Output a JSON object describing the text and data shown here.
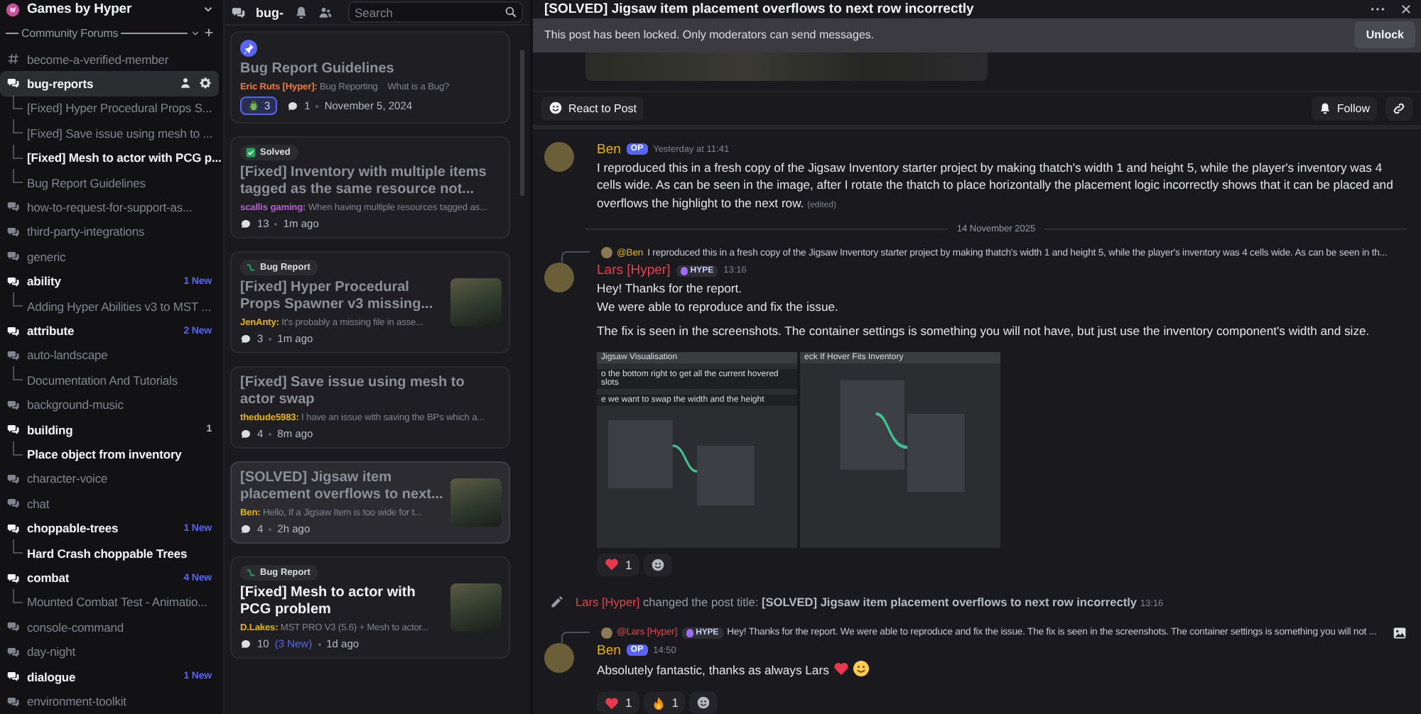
{
  "server": {
    "name": "Games by Hyper"
  },
  "sidebar": {
    "category": "Community Forums",
    "channels": [
      {
        "name": "become-a-verified-member",
        "kind": "text",
        "unread": false,
        "selected": false
      },
      {
        "name": "bug-reports",
        "kind": "forum",
        "unread": true,
        "selected": true,
        "threads": [
          {
            "title": "[Fixed] Hyper Procedural Props S...",
            "unread": false
          },
          {
            "title": "[Fixed] Save issue using mesh to ...",
            "unread": false
          },
          {
            "title": "[Fixed] Mesh to actor with PCG p...",
            "unread": true
          },
          {
            "title": "Bug Report Guidelines",
            "unread": false
          }
        ]
      },
      {
        "name": "how-to-request-for-support-as...",
        "kind": "forum",
        "unread": false,
        "selected": false
      },
      {
        "name": "third-party-integrations",
        "kind": "forum",
        "unread": false,
        "selected": false
      },
      {
        "name": "generic",
        "kind": "forum",
        "unread": false,
        "selected": false
      },
      {
        "name": "ability",
        "kind": "forum",
        "unread": true,
        "selected": false,
        "badge": {
          "text": "1 New",
          "kind": "new"
        },
        "threads": [
          {
            "title": "Adding Hyper Abilities v3 to MST ...",
            "unread": false
          }
        ]
      },
      {
        "name": "attribute",
        "kind": "forum",
        "unread": true,
        "selected": false,
        "badge": {
          "text": "2 New",
          "kind": "new"
        }
      },
      {
        "name": "auto-landscape",
        "kind": "forum",
        "unread": false,
        "selected": false,
        "threads": [
          {
            "title": "Documentation And Tutorials",
            "unread": false
          }
        ]
      },
      {
        "name": "background-music",
        "kind": "forum",
        "unread": false,
        "selected": false
      },
      {
        "name": "building",
        "kind": "forum",
        "unread": true,
        "selected": false,
        "badge": {
          "text": "1",
          "kind": "count"
        },
        "threads": [
          {
            "title": "Place object from inventory",
            "unread": true
          }
        ]
      },
      {
        "name": "character-voice",
        "kind": "forum",
        "unread": false,
        "selected": false
      },
      {
        "name": "chat",
        "kind": "forum",
        "unread": false,
        "selected": false
      },
      {
        "name": "choppable-trees",
        "kind": "forum",
        "unread": true,
        "selected": false,
        "badge": {
          "text": "1 New",
          "kind": "new"
        },
        "threads": [
          {
            "title": "Hard Crash choppable Trees",
            "unread": true
          }
        ]
      },
      {
        "name": "combat",
        "kind": "forum",
        "unread": true,
        "selected": false,
        "badge": {
          "text": "4 New",
          "kind": "new"
        },
        "threads": [
          {
            "title": "Mounted Combat Test - Animatio...",
            "unread": false
          }
        ]
      },
      {
        "name": "console-command",
        "kind": "forum",
        "unread": false,
        "selected": false
      },
      {
        "name": "day-night",
        "kind": "forum",
        "unread": false,
        "selected": false
      },
      {
        "name": "dialogue",
        "kind": "forum",
        "unread": true,
        "selected": false,
        "badge": {
          "text": "1 New",
          "kind": "new"
        }
      },
      {
        "name": "environment-toolkit",
        "kind": "forum",
        "unread": false,
        "selected": false
      }
    ]
  },
  "forum": {
    "channel_name": "bug-",
    "search": {
      "placeholder": "Search"
    },
    "posts": [
      {
        "pinned": true,
        "title": "Bug Report Guidelines",
        "unread": false,
        "selected": false,
        "author": {
          "name": "Eric Ruts [Hyper]:",
          "color": "#f0783c"
        },
        "snippet": "Bug Reporting    What is a Bug?",
        "reaction": {
          "count": "3"
        },
        "comments": "1",
        "time": "November 5, 2024",
        "thumbnail": false
      },
      {
        "pinned": false,
        "tag": {
          "label": "Solved",
          "kind": "solved"
        },
        "title": "[Fixed] Inventory with multiple items tagged as the same resource not...",
        "unread": false,
        "selected": false,
        "author": {
          "name": "scallis gaming:",
          "color": "#b55fd0"
        },
        "snippet": "When having multiple resources tagged as...",
        "comments": "13",
        "time": "1m ago",
        "thumbnail": false
      },
      {
        "pinned": false,
        "tag": {
          "label": "Bug Report",
          "kind": "bug"
        },
        "title": "[Fixed] Hyper Procedural Props Spawner v3 missing...",
        "unread": false,
        "selected": false,
        "author": {
          "name": "JenAnty:",
          "color": "#e8b400"
        },
        "snippet": "It's probably a missing file in asse...",
        "comments": "3",
        "time": "1m ago",
        "thumbnail": true
      },
      {
        "pinned": false,
        "title": "[Fixed] Save issue using mesh to actor swap",
        "unread": false,
        "selected": false,
        "author": {
          "name": "thedude5983:",
          "color": "#e8b400"
        },
        "snippet": "I have an issue with saving the BPs which a...",
        "comments": "4",
        "time": "8m ago",
        "thumbnail": false
      },
      {
        "pinned": false,
        "title": "[SOLVED] Jigsaw item placement overflows to next...",
        "unread": false,
        "selected": true,
        "author": {
          "name": "Ben:",
          "color": "#e8b400"
        },
        "snippet": "Hello, If a Jigsaw Item is too wide for t...",
        "comments": "4",
        "time": "2h ago",
        "thumbnail": true
      },
      {
        "pinned": false,
        "tag": {
          "label": "Bug Report",
          "kind": "bug"
        },
        "title": "[Fixed] Mesh to actor with PCG problem",
        "unread": true,
        "selected": false,
        "author": {
          "name": "D.Lakes:",
          "color": "#e8b400"
        },
        "snippet": "MST PRO V3 (5.6) + Mesh to actor...",
        "comments": "10",
        "new_comments": "(3 New)",
        "time": "1d ago",
        "thumbnail": true
      }
    ]
  },
  "thread": {
    "title": "[SOLVED] Jigsaw item placement overflows to next row incorrectly",
    "locked_notice": "This post has been locked. Only moderators can send messages.",
    "unlock_button": "Unlock",
    "react_button": "React to Post",
    "follow_button": "Follow",
    "items": [
      {
        "kind": "message",
        "author": {
          "name": "Ben",
          "color": "#e8b400"
        },
        "badge": {
          "text": "OP",
          "kind": "op"
        },
        "time": "Yesterday at 11:41",
        "paragraphs": [
          [
            "I reproduced this in a fresh copy of the Jigsaw Inventory starter project by making thatch's width 1 and height 5, while the player's inventory was 4 cells wide. As can be seen in the image, after I rotate the thatch to place horizontally the placement logic incorrectly shows that it can be placed and overflows the highlight to the next row."
          ]
        ],
        "edited": "(edited)"
      },
      {
        "kind": "divider",
        "text": "14 November 2025"
      },
      {
        "kind": "message",
        "reply": {
          "author": {
            "name": "@Ben",
            "color": "#e8b400"
          },
          "text": "I reproduced this in a fresh copy of the Jigsaw Inventory starter project by making thatch's width 1 and height 5, while the player's inventory was 4 cells wide. As can be seen in th..."
        },
        "author": {
          "name": "Lars [Hyper]",
          "color": "#e0454f"
        },
        "badge": {
          "text": "HYPE",
          "kind": "hype"
        },
        "time": "13:16",
        "paragraphs": [
          [
            "Hey! Thanks for the report.",
            "We were able to reproduce and fix the issue."
          ],
          [
            "The fix is seen in the screenshots. The container settings is something you will not have, but just use the inventory component's width and size."
          ]
        ],
        "attachments": [
          {
            "captions": [
              "Jigsaw Visualisation",
              "o the bottom right to get all the current hovered slots",
              "e we want to swap the width and the height"
            ]
          },
          {
            "captions": [
              "eck If Hover Fits Inventory"
            ]
          }
        ],
        "reactions": [
          {
            "kind": "heart",
            "count": "1"
          }
        ]
      },
      {
        "kind": "system",
        "actor": {
          "name": "Lars [Hyper]",
          "color": "#e0454f"
        },
        "action": "changed the post title:",
        "new_title": "[SOLVED] Jigsaw item placement overflows to next row incorrectly",
        "time": "13:16"
      },
      {
        "kind": "message",
        "reply": {
          "author": {
            "name": "@Lars [Hyper]",
            "color": "#e0454f"
          },
          "badge": {
            "text": "HYPE",
            "kind": "hype"
          },
          "text": "Hey! Thanks for the report. We were able to reproduce and fix the issue.  The fix is seen in the screenshots. The container settings is something you will not ...",
          "has_image": true
        },
        "author": {
          "name": "Ben",
          "color": "#e8b400"
        },
        "badge": {
          "text": "OP",
          "kind": "op"
        },
        "time": "14:50",
        "paragraphs": [
          [
            "Absolutely fantastic, thanks as always Lars"
          ]
        ],
        "emojis": [
          {
            "kind": "heart"
          },
          {
            "kind": "smile"
          }
        ],
        "reactions": [
          {
            "kind": "heart",
            "count": "1"
          },
          {
            "kind": "fire",
            "count": "1"
          }
        ]
      }
    ]
  }
}
